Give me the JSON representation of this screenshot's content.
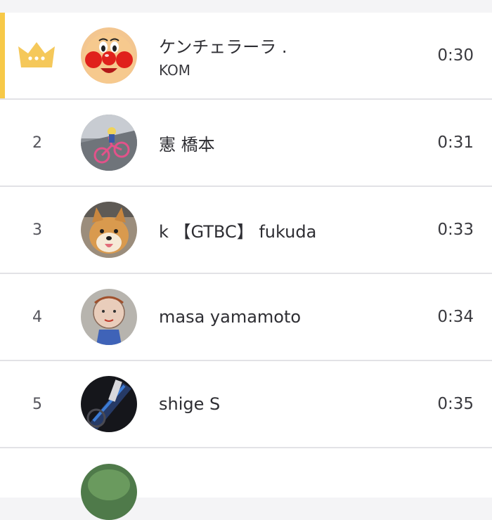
{
  "leaderboard": {
    "rows": [
      {
        "rank": "",
        "name": "ケンチェラーラ .",
        "sub": "KOM",
        "time": "0:30",
        "avatar": "anpanman-avatar"
      },
      {
        "rank": "2",
        "name": "憲 橋本",
        "sub": "",
        "time": "0:31",
        "avatar": "bicycle-photo-avatar"
      },
      {
        "rank": "3",
        "name": "k 【GTBC】 fukuda",
        "sub": "",
        "time": "0:33",
        "avatar": "shiba-dog-avatar"
      },
      {
        "rank": "4",
        "name": "masa yamamoto",
        "sub": "",
        "time": "0:34",
        "avatar": "drawing-avatar"
      },
      {
        "rank": "5",
        "name": "shige S",
        "sub": "",
        "time": "0:35",
        "avatar": "bike-frame-avatar"
      }
    ]
  },
  "colors": {
    "kom_accent": "#f7c948"
  },
  "icons": {
    "first_place": "crown-icon"
  }
}
